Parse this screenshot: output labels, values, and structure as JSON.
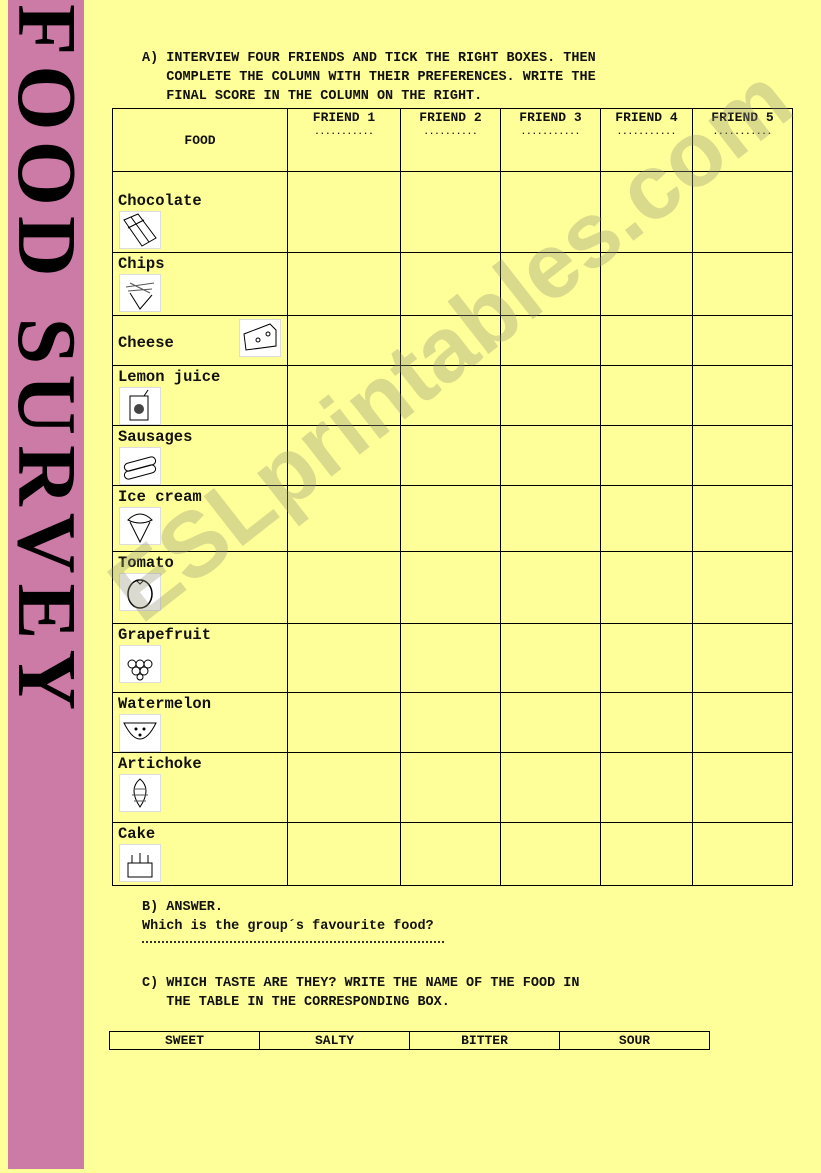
{
  "sidebar": {
    "title": "FOOD SURVEY",
    "color": "#cc7aa6"
  },
  "section_a": {
    "line1": "A) INTERVIEW FOUR FRIENDS AND TICK THE RIGHT BOXES. THEN",
    "line2": "   COMPLETE THE COLUMN WITH THEIR PREFERENCES. WRITE THE",
    "line3": "   FINAL SCORE IN THE COLUMN ON THE RIGHT."
  },
  "table": {
    "food_header": "FOOD",
    "friends": [
      {
        "label": "FRIEND 1",
        "blank": "..........."
      },
      {
        "label": "FRIEND 2",
        "blank": ".........."
      },
      {
        "label": "FRIEND 3",
        "blank": "..........."
      },
      {
        "label": "FRIEND 4",
        "blank": "..........."
      },
      {
        "label": "FRIEND 5",
        "blank": "..........."
      }
    ],
    "foods": [
      {
        "name": "Chocolate",
        "icon": "chocolate-icon"
      },
      {
        "name": "Chips",
        "icon": "chips-icon"
      },
      {
        "name": "Cheese",
        "icon": "cheese-icon"
      },
      {
        "name": "Lemon juice",
        "icon": "juice-box-icon"
      },
      {
        "name": "Sausages",
        "icon": "sausage-icon"
      },
      {
        "name": "Ice cream",
        "icon": "ice-cream-icon"
      },
      {
        "name": "Tomato",
        "icon": "tomato-icon"
      },
      {
        "name": "Grapefruit",
        "icon": "grapes-icon"
      },
      {
        "name": "Watermelon",
        "icon": "watermelon-icon"
      },
      {
        "name": "Artichoke",
        "icon": "artichoke-icon"
      },
      {
        "name": "Cake",
        "icon": "cake-icon"
      }
    ]
  },
  "section_b": {
    "heading": "B) ANSWER.",
    "question": "Which is the group´s favourite food?"
  },
  "section_c": {
    "line1": "C) WHICH TASTE ARE THEY? WRITE THE NAME OF THE FOOD IN",
    "line2": "   THE TABLE IN THE CORRESPONDING BOX."
  },
  "taste_table": [
    "SWEET",
    "SALTY",
    "BITTER",
    "SOUR"
  ],
  "watermark": "ESLprintables.com"
}
